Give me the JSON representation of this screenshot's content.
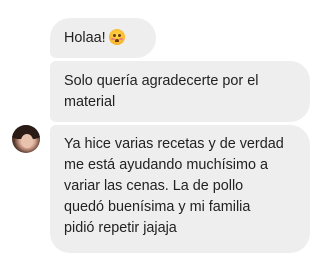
{
  "messages": [
    {
      "lines": [
        "Holaa!"
      ],
      "emoji": "pleading-face-emoji"
    },
    {
      "lines": [
        "Solo quería agradecerte por el",
        "material"
      ]
    },
    {
      "lines": [
        "Ya hice varias recetas y de verdad",
        "me está ayudando muchísimo a",
        "variar las cenas. La de pollo",
        "quedó buenísima y mi familia",
        "pidió repetir jajaja"
      ]
    }
  ],
  "sender": {
    "avatar_icon": "profile-photo"
  },
  "colors": {
    "bubble": "#eeeeee",
    "text": "#222222",
    "background": "#ffffff"
  }
}
